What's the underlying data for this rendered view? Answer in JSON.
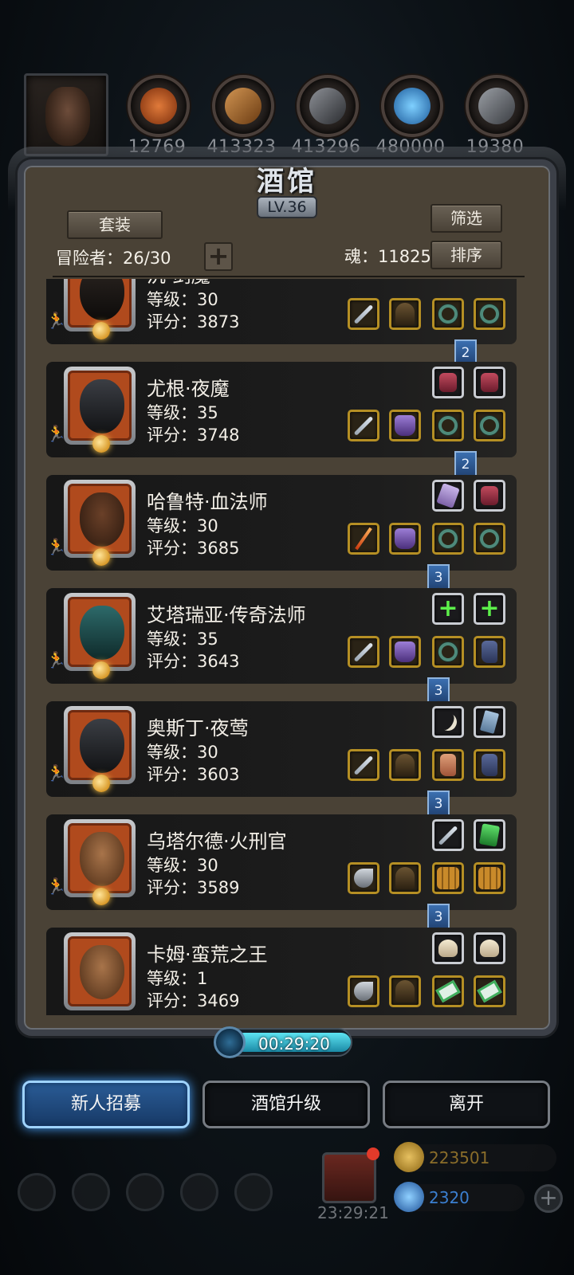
{
  "resources": [
    {
      "name": "meat",
      "value": "12769",
      "color": "#b4531f"
    },
    {
      "name": "wood",
      "value": "413323",
      "color": "#a36a2e"
    },
    {
      "name": "stone",
      "value": "413296",
      "color": "#5a5d62"
    },
    {
      "name": "crystal",
      "value": "480000",
      "color": "#2f8fd6"
    },
    {
      "name": "iron",
      "value": "19380",
      "color": "#6d7075"
    }
  ],
  "panel": {
    "title": "酒馆",
    "level": "LV.36",
    "suit_button": "套装",
    "filter_button": "筛选",
    "sort_button": "排序",
    "adventurers": "冒险者：26/30",
    "soul": "魂：11825",
    "add_button": "+"
  },
  "heroes": [
    {
      "name": "沉·剑魔",
      "level": "等级：30",
      "score": "评分：3873"
    },
    {
      "name": "尤根·夜魔",
      "level": "等级：35",
      "score": "评分：3748"
    },
    {
      "name": "哈鲁特·血法师",
      "level": "等级：30",
      "score": "评分：3685"
    },
    {
      "name": "艾塔瑞亚·传奇法师",
      "level": "等级：35",
      "score": "评分：3643"
    },
    {
      "name": "奥斯丁·夜莺",
      "level": "等级：30",
      "score": "评分：3603"
    },
    {
      "name": "乌塔尔德·火刑官",
      "level": "等级：30",
      "score": "评分：3589"
    },
    {
      "name": "卡姆·蛮荒之王",
      "level": "等级：1",
      "score": "评分：3469"
    }
  ],
  "tags": [
    "2",
    "2",
    "3",
    "3",
    "3",
    "3"
  ],
  "timer": "00:29:20",
  "actions": {
    "recruit": "新人招募",
    "upgrade": "酒馆升级",
    "leave": "离开"
  },
  "hud": {
    "gift_timer": "23:29:21",
    "gold": "223501",
    "gems": "2320",
    "gold_color": "#b08a2a",
    "gem_color": "#3b7fd0"
  },
  "colors": {
    "accent_blue": "#4aa3ff",
    "slot_gold": "#b58f24",
    "portrait_orange": "#b04a1d"
  }
}
